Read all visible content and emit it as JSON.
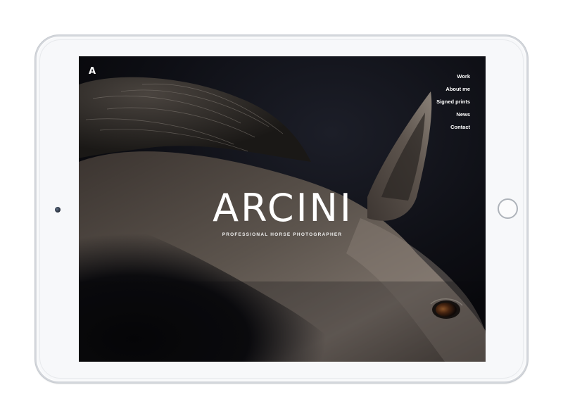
{
  "site": {
    "logo": "A",
    "nav": [
      "Work",
      "About me",
      "Signed prints",
      "News",
      "Contact"
    ],
    "hero_title": "ARCINI",
    "hero_subtitle": "PROFESSIONAL HORSE PHOTOGRAPHER",
    "background_image": "horse-head-closeup-photo"
  },
  "device": {
    "type": "tablet",
    "color": "#f7f8fa",
    "frame_color": "#d4d7dc"
  },
  "colors": {
    "screen_bg": "#0c0c10",
    "text": "#ffffff"
  }
}
